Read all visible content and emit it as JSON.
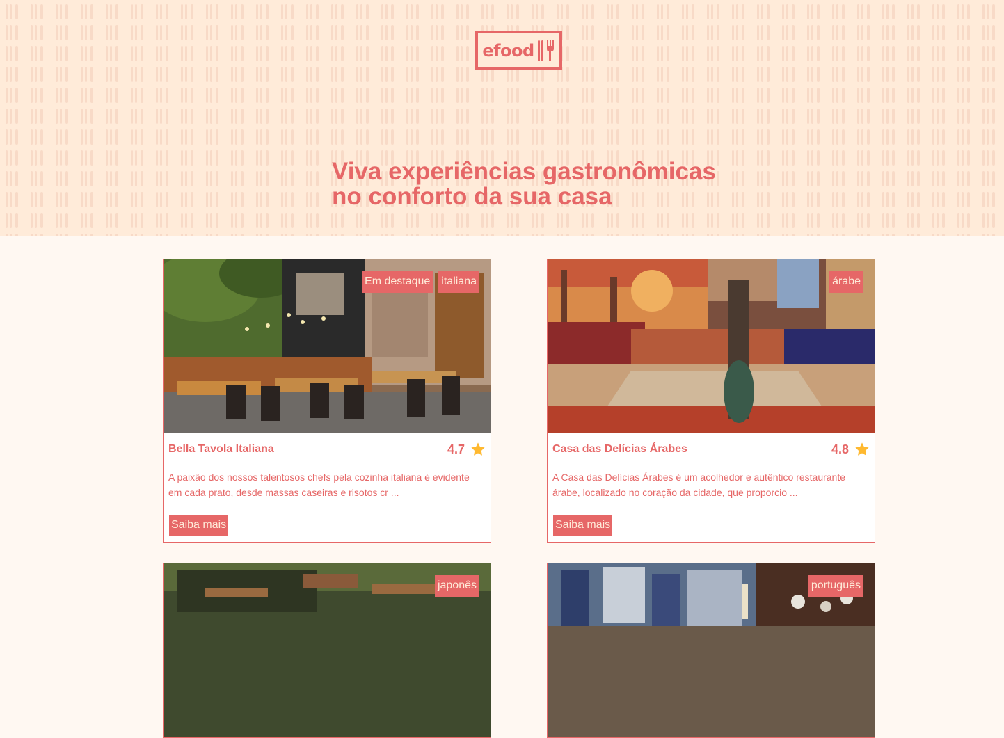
{
  "header": {
    "logo_text": "efood",
    "headline_line1": "Viva experiências gastronômicas",
    "headline_line2": "no conforto da sua casa"
  },
  "colors": {
    "primary": "#E66767",
    "hero_bg": "#FFEBD9",
    "page_bg": "#FFF8F2",
    "star": "#FFB930"
  },
  "restaurants": [
    {
      "name": "Bella Tavola Italiana",
      "rating": "4.7",
      "tags": [
        "Em destaque",
        "italiana"
      ],
      "description": "A paixão dos nossos talentosos chefs pela cozinha italiana é evidente em cada prato, desde massas caseiras e risotos cr ...",
      "button": "Saiba mais"
    },
    {
      "name": "Casa das Delícias Árabes",
      "rating": "4.8",
      "tags": [
        "árabe"
      ],
      "description": "A Casa das Delícias Árabes é um acolhedor e autêntico restaurante árabe, localizado no coração da cidade, que proporcio ...",
      "button": "Saiba mais"
    },
    {
      "tags": [
        "japonês"
      ]
    },
    {
      "tags": [
        "português"
      ]
    }
  ]
}
